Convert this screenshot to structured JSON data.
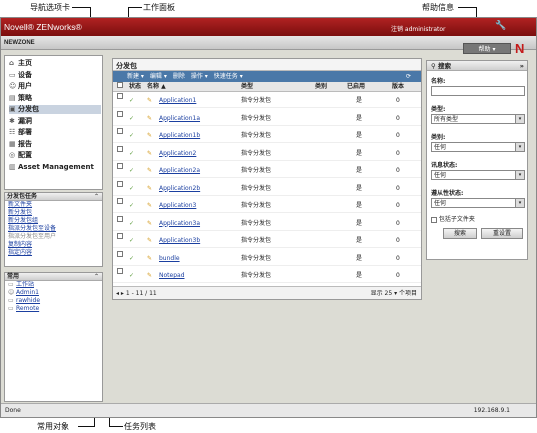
{
  "callouts": {
    "nav_tabs": "导航选项卡",
    "work_panel": "工作面板",
    "help_info": "帮助信息",
    "common_objects": "常用对象",
    "task_list": "任务列表"
  },
  "header": {
    "brand": "Novell® ZENworks®",
    "user_link": "注销 administrator",
    "zone": "NEWZONE",
    "help_button": "帮助 ▾",
    "logo": "N"
  },
  "nav": {
    "items": [
      {
        "icon": "home-icon",
        "glyph": "⌂",
        "label": "主页"
      },
      {
        "icon": "device-icon",
        "glyph": "▭",
        "label": "设备"
      },
      {
        "icon": "user-icon",
        "glyph": "☺",
        "label": "用户"
      },
      {
        "icon": "policy-icon",
        "glyph": "▤",
        "label": "策略"
      },
      {
        "icon": "bundle-icon",
        "glyph": "▣",
        "label": "分发包",
        "selected": true
      },
      {
        "icon": "vulnerability-icon",
        "glyph": "✱",
        "label": "漏洞"
      },
      {
        "icon": "deployment-icon",
        "glyph": "☷",
        "label": "部署"
      },
      {
        "icon": "report-icon",
        "glyph": "▦",
        "label": "报告"
      },
      {
        "icon": "config-icon",
        "glyph": "◎",
        "label": "配置"
      },
      {
        "icon": "asset-icon",
        "glyph": "▥",
        "label": "Asset Management"
      }
    ]
  },
  "tasks": {
    "title": "分发包任务",
    "items": [
      {
        "label": "新文件夹",
        "enabled": true
      },
      {
        "label": "新分发包",
        "enabled": true
      },
      {
        "label": "新分发包组",
        "enabled": true
      },
      {
        "label": "指派分发包至设备",
        "enabled": true
      },
      {
        "label": "指派分发包至用户",
        "enabled": false
      },
      {
        "label": "复制内容",
        "enabled": true
      },
      {
        "label": "指定内容",
        "enabled": true
      }
    ]
  },
  "favorites": {
    "title": "常用",
    "items": [
      {
        "icon": "folder-icon",
        "glyph": "▭",
        "label": "工作站"
      },
      {
        "icon": "user-icon",
        "glyph": "☺",
        "label": "Admin1"
      },
      {
        "icon": "device-icon",
        "glyph": "▭",
        "label": "rawhide"
      },
      {
        "icon": "device-icon",
        "glyph": "▭",
        "label": "Remote"
      }
    ]
  },
  "work": {
    "title": "分发包",
    "toolbar": [
      "新建 ▾",
      "编辑 ▾",
      "删除",
      "操作 ▾",
      "快速任务 ▾"
    ],
    "columns": {
      "status": "状态",
      "name": "名称 ▲",
      "type": "类型",
      "category": "类别",
      "enabled": "已启用",
      "version": "版本"
    },
    "rows": [
      {
        "name": "Application1",
        "type": "指令分发包",
        "category": "",
        "enabled": "是",
        "version": "0"
      },
      {
        "name": "Application1a",
        "type": "指令分发包",
        "category": "",
        "enabled": "是",
        "version": "0"
      },
      {
        "name": "Application1b",
        "type": "指令分发包",
        "category": "",
        "enabled": "是",
        "version": "0"
      },
      {
        "name": "Application2",
        "type": "指令分发包",
        "category": "",
        "enabled": "是",
        "version": "0"
      },
      {
        "name": "Application2a",
        "type": "指令分发包",
        "category": "",
        "enabled": "是",
        "version": "0"
      },
      {
        "name": "Application2b",
        "type": "指令分发包",
        "category": "",
        "enabled": "是",
        "version": "0"
      },
      {
        "name": "Application3",
        "type": "指令分发包",
        "category": "",
        "enabled": "是",
        "version": "0"
      },
      {
        "name": "Application3a",
        "type": "指令分发包",
        "category": "",
        "enabled": "是",
        "version": "0"
      },
      {
        "name": "Application3b",
        "type": "指令分发包",
        "category": "",
        "enabled": "是",
        "version": "0"
      },
      {
        "name": "bundle",
        "type": "指令分发包",
        "category": "",
        "enabled": "是",
        "version": "0"
      },
      {
        "name": "Notepad",
        "type": "指令分发包",
        "category": "",
        "enabled": "是",
        "version": "0"
      }
    ],
    "pager_left": "◂  ▸  1 - 11 / 11",
    "pager_right": "显示  25 ▾  个项目"
  },
  "search": {
    "title": "搜索",
    "name_label": "名称:",
    "name_value": "",
    "type_label": "类型:",
    "type_value": "所有类型",
    "category_label": "类别:",
    "category_value": "任何",
    "error_label": "讯息状态:",
    "error_value": "任何",
    "compliance_label": "遵从性状态:",
    "compliance_value": "任何",
    "subfolders_label": "包括子文件夹",
    "search_button": "搜索",
    "reset_button": "重设置"
  },
  "status_bar": {
    "left": "Done",
    "ip": "192.168.9.1"
  }
}
